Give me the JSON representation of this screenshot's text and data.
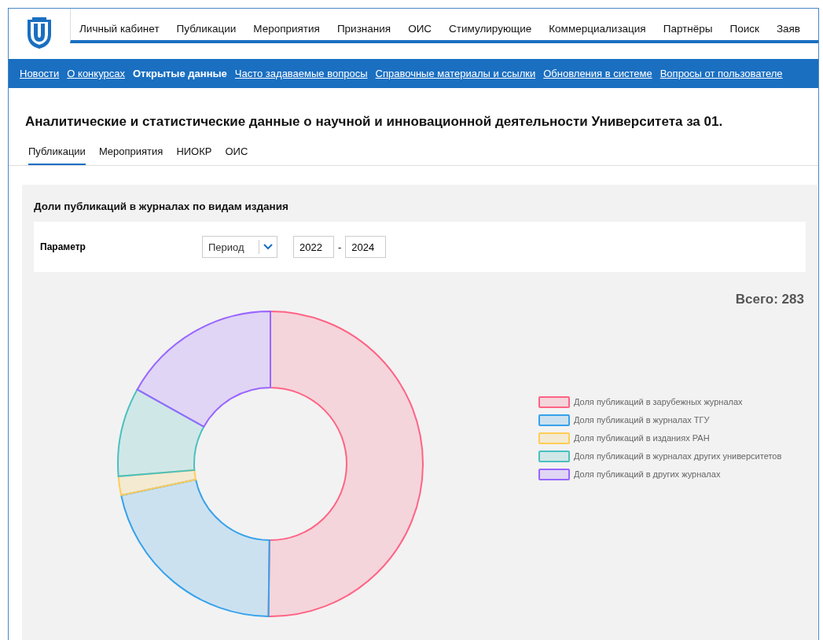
{
  "top_nav": {
    "items": [
      {
        "label": "Личный кабинет"
      },
      {
        "label": "Публикации"
      },
      {
        "label": "Мероприятия"
      },
      {
        "label": "Признания"
      },
      {
        "label": "ОИС"
      },
      {
        "label": "Стимулирующие"
      },
      {
        "label": "Коммерциализация"
      },
      {
        "label": "Партнёры"
      },
      {
        "label": "Поиск"
      },
      {
        "label": "Заяв"
      }
    ]
  },
  "sub_nav": {
    "items": [
      {
        "label": "Новости",
        "selected": false
      },
      {
        "label": "О конкурсах",
        "selected": false
      },
      {
        "label": "Открытые данные",
        "selected": true
      },
      {
        "label": "Часто задаваемые вопросы",
        "selected": false
      },
      {
        "label": "Справочные материалы и ссылки",
        "selected": false
      },
      {
        "label": "Обновления в системе",
        "selected": false
      },
      {
        "label": "Вопросы от пользователе",
        "selected": false
      }
    ]
  },
  "page": {
    "title": "Аналитические и статистические данные о научной и инновационной деятельности Университета за 01.",
    "tabs": [
      {
        "label": "Публикации",
        "selected": true
      },
      {
        "label": "Мероприятия",
        "selected": false
      },
      {
        "label": "НИОКР",
        "selected": false
      },
      {
        "label": "ОИС",
        "selected": false
      }
    ]
  },
  "panel": {
    "title": "Доли публикаций в журналах по видам издания",
    "filter": {
      "label": "Параметр",
      "select_value": "Период",
      "from": "2022",
      "separator": "-",
      "to": "2024"
    },
    "total": "Всего: 283",
    "legend": [
      {
        "label": "Доля публикаций в зарубежных журналах",
        "color": "#ff6384"
      },
      {
        "label": "Доля публикаций в журналах ТГУ",
        "color": "#36a2eb"
      },
      {
        "label": "Доля публикаций в изданиях РАН",
        "color": "#ffcd56"
      },
      {
        "label": "Доля публикаций в журналах других университетов",
        "color": "#4bc0c0"
      },
      {
        "label": "Доля публикаций в других журналах",
        "color": "#9966ff"
      }
    ]
  }
}
